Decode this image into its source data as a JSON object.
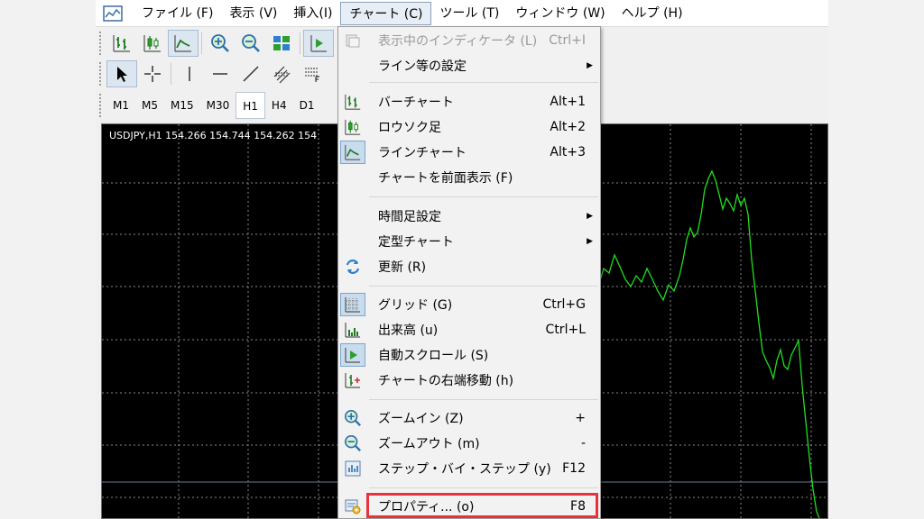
{
  "menubar": {
    "items": [
      "ファイル (F)",
      "表示 (V)",
      "挿入(I)",
      "チャート (C)",
      "ツール (T)",
      "ウィンドウ (W)",
      "ヘルプ (H)"
    ]
  },
  "timeframes": [
    "M1",
    "M5",
    "M15",
    "M30",
    "H1",
    "H4",
    "D1"
  ],
  "active_timeframe": "H1",
  "chart": {
    "label": "USDJPY,H1  154.266 154.744 154.262 154"
  },
  "dropdown": {
    "items": [
      {
        "label": "表示中のインディケータ (L)",
        "shortcut": "Ctrl+I",
        "icon": "indicators-icon",
        "disabled": true
      },
      {
        "label": "ライン等の設定",
        "submenu": true
      },
      {
        "label": "バーチャート",
        "shortcut": "Alt+1",
        "icon": "bar-chart-icon"
      },
      {
        "label": "ロウソク足",
        "shortcut": "Alt+2",
        "icon": "candlestick-icon"
      },
      {
        "label": "ラインチャート",
        "shortcut": "Alt+3",
        "icon": "line-chart-icon",
        "checked": true
      },
      {
        "label": "チャートを前面表示 (F)"
      },
      {
        "label": "時間足設定",
        "submenu": true
      },
      {
        "label": "定型チャート",
        "submenu": true
      },
      {
        "label": "更新 (R)",
        "icon": "refresh-icon"
      },
      {
        "label": "グリッド (G)",
        "shortcut": "Ctrl+G",
        "icon": "grid-icon",
        "checked": true
      },
      {
        "label": "出来高 (u)",
        "shortcut": "Ctrl+L",
        "icon": "volume-icon"
      },
      {
        "label": "自動スクロール (S)",
        "icon": "auto-scroll-icon",
        "checked": true
      },
      {
        "label": "チャートの右端移動 (h)",
        "icon": "chart-shift-icon"
      },
      {
        "label": "ズームイン (Z)",
        "shortcut": "+",
        "icon": "zoom-in-icon"
      },
      {
        "label": "ズームアウト (m)",
        "shortcut": "-",
        "icon": "zoom-out-icon"
      },
      {
        "label": "ステップ・バイ・ステップ (y)",
        "shortcut": "F12",
        "icon": "step-by-step-icon"
      },
      {
        "label": "プロパティ... (o)",
        "shortcut": "F8",
        "icon": "properties-icon",
        "highlighted": true
      }
    ]
  },
  "colors": {
    "chart_background": "#000000",
    "price_line": "#22dd22",
    "grid": "#888888",
    "highlight_box": "#e8333a"
  }
}
